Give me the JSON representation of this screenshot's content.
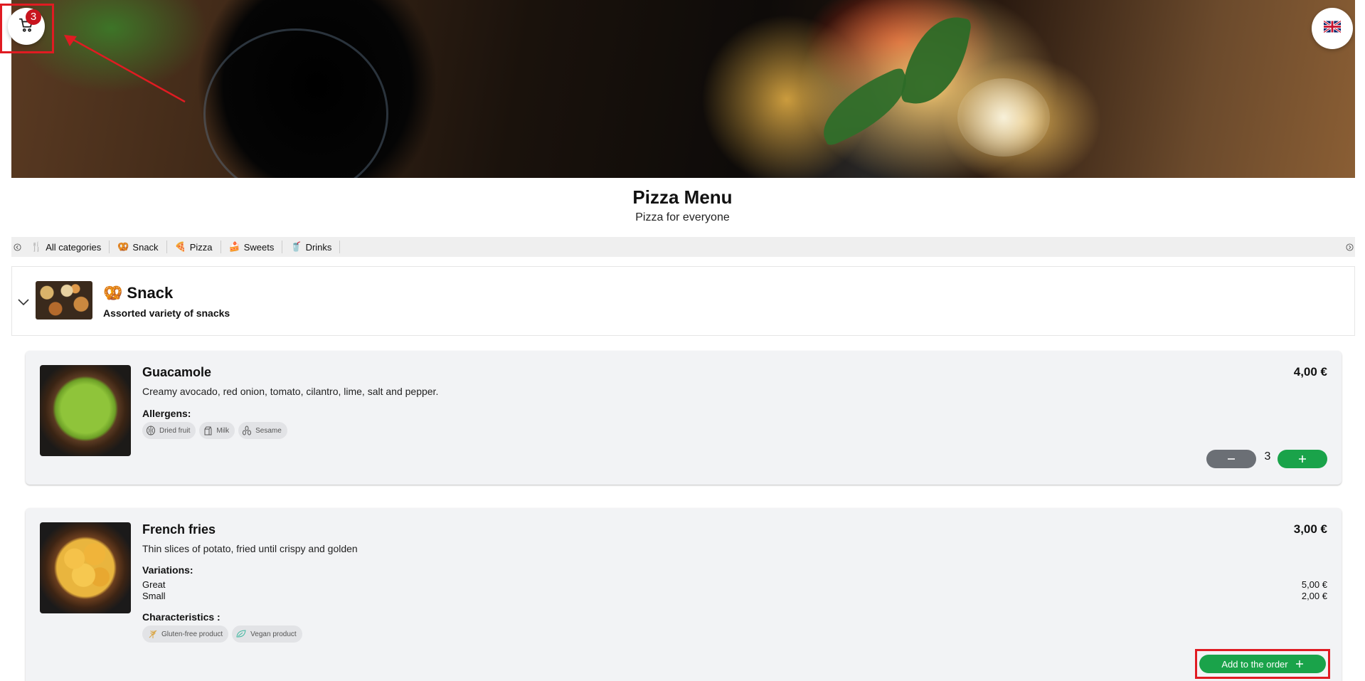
{
  "header": {
    "cart_count": "3",
    "language_flag": "🇬🇧"
  },
  "menu": {
    "title": "Pizza Menu",
    "subtitle": "Pizza for everyone"
  },
  "categories": [
    {
      "icon": "🍴",
      "label": "All categories"
    },
    {
      "icon": "🥨",
      "label": "Snack"
    },
    {
      "icon": "🍕",
      "label": "Pizza"
    },
    {
      "icon": "🍰",
      "label": "Sweets"
    },
    {
      "icon": "🥤",
      "label": "Drinks"
    }
  ],
  "section": {
    "icon": "🥨",
    "name": "Snack",
    "description": "Assorted variety of snacks"
  },
  "products": [
    {
      "name": "Guacamole",
      "price": "4,00 €",
      "description": "Creamy avocado, red onion, tomato, cilantro, lime, salt and pepper.",
      "allergens_label": "Allergens:",
      "allergens": [
        "Dried fruit",
        "Milk",
        "Sesame"
      ],
      "quantity": "3"
    },
    {
      "name": "French fries",
      "price": "3,00 €",
      "description": "Thin slices of potato, fried until crispy and golden",
      "variations_label": "Variations:",
      "variations": [
        {
          "name": "Great",
          "price": "5,00 €"
        },
        {
          "name": "Small",
          "price": "2,00 €"
        }
      ],
      "characteristics_label": "Characteristics :",
      "characteristics": [
        "Gluten-free product",
        "Vegan product"
      ],
      "add_label": "Add to the order"
    }
  ],
  "colors": {
    "accent_green": "#1aa34a",
    "minus_gray": "#6b6f75",
    "badge_red": "#c8141e",
    "highlight_red": "#e01b22"
  }
}
